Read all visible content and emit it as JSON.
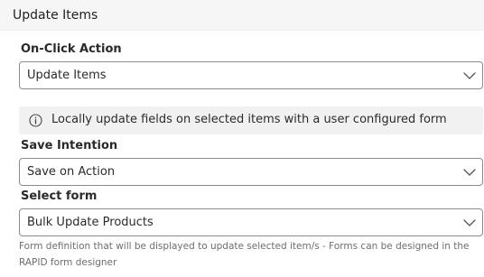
{
  "header": {
    "title": "Update Items"
  },
  "on_click_action": {
    "label": "On-Click Action",
    "value": "Update Items",
    "icon": "chevron-down-icon"
  },
  "info": {
    "icon": "info-icon",
    "text": "Locally update fields on selected items with a user configured form"
  },
  "save_intention": {
    "label": "Save Intention",
    "value": "Save on Action",
    "icon": "chevron-down-icon"
  },
  "select_form": {
    "label": "Select form",
    "value": "Bulk Update Products",
    "icon": "chevron-down-icon",
    "help": "Form definition that will be displayed to update selected item/s - Forms can be designed in the RAPID form designer"
  }
}
